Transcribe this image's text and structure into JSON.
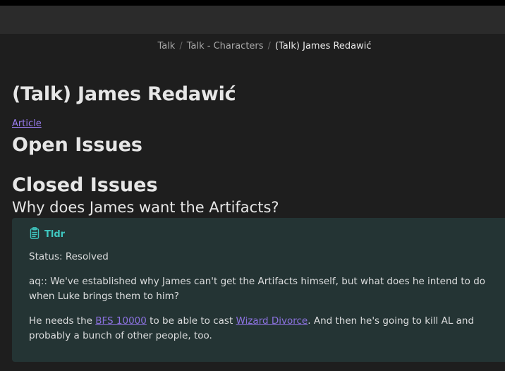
{
  "breadcrumb": {
    "items": [
      "Talk",
      "Talk - Characters"
    ],
    "current": "(Talk) James Redawić"
  },
  "page": {
    "title": "(Talk) James Redawić",
    "article_link": "Article",
    "open_issues_heading": "Open Issues",
    "closed_issues_heading": "Closed Issues",
    "question_heading": "Why does James want the Artifacts?"
  },
  "callout": {
    "icon": "clipboard-icon",
    "title": "Tldr",
    "status": "Status: Resolved",
    "question": "aq:: We've established why James can't get the Artifacts himself, but what does he intend to do when Luke brings them to him?",
    "answer_part1": "He needs the ",
    "answer_link1": "BFS 10000",
    "answer_part2": " to be able to cast ",
    "answer_link2": "Wizard Divorce",
    "answer_part3": ". And then he's going to kill AL and probably a bunch of other people, too."
  },
  "colors": {
    "background": "#1e1e1e",
    "callout_bg": "#243434",
    "callout_accent": "#3fc7c0",
    "link": "#9a7cf0"
  }
}
